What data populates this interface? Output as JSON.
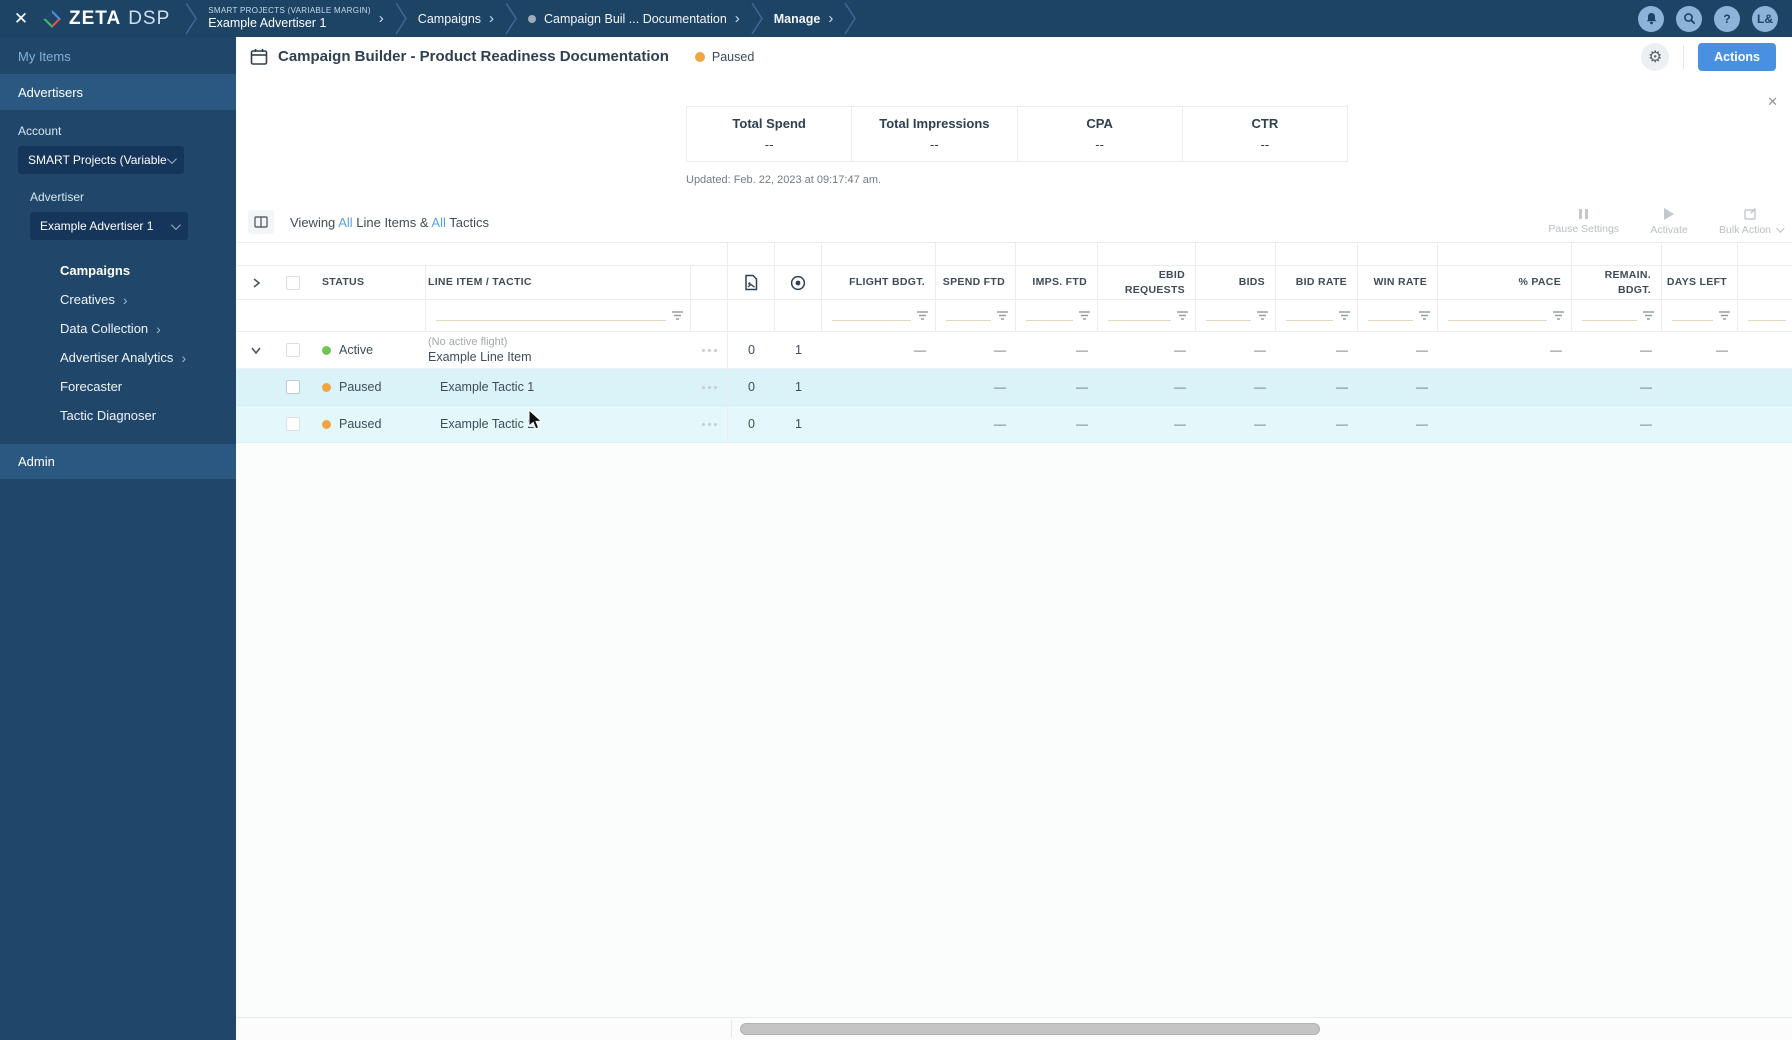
{
  "icons": {
    "close": "✕",
    "gear": "⚙",
    "help": "?",
    "chevron_right": "›"
  },
  "topbar": {
    "brand": "ZETA",
    "product": "DSP",
    "breadcrumb": {
      "account_small": "SMART PROJECTS (VARIABLE MARGIN)",
      "advertiser": "Example Advertiser 1",
      "campaigns": "Campaigns",
      "campaign": "Campaign Buil ... Documentation",
      "manage": "Manage"
    },
    "avatar_initials": "L&"
  },
  "sidebar": {
    "my_items": "My Items",
    "advertisers": "Advertisers",
    "account_label": "Account",
    "account_value": "SMART Projects (Variable M...",
    "advertiser_label": "Advertiser",
    "advertiser_value": "Example Advertiser 1",
    "nav": [
      {
        "label": "Campaigns"
      },
      {
        "label": "Creatives"
      },
      {
        "label": "Data Collection"
      },
      {
        "label": "Advertiser Analytics"
      },
      {
        "label": "Forecaster"
      },
      {
        "label": "Tactic Diagnoser"
      }
    ],
    "admin": "Admin"
  },
  "header": {
    "title": "Campaign Builder - Product Readiness Documentation",
    "status": "Paused",
    "actions_button": "Actions"
  },
  "summary": {
    "stats": [
      {
        "label": "Total Spend",
        "value": "--"
      },
      {
        "label": "Total Impressions",
        "value": "--"
      },
      {
        "label": "CPA",
        "value": "--"
      },
      {
        "label": "CTR",
        "value": "--"
      }
    ],
    "updated": "Updated: Feb. 22, 2023 at 09:17:47 am."
  },
  "toolbar": {
    "viewing_prefix": "Viewing ",
    "all_1": "All",
    "viewing_mid": " Line Items & ",
    "all_2": "All",
    "viewing_suffix": " Tactics",
    "pause_settings": "Pause Settings",
    "activate": "Activate",
    "bulk_action": "Bulk Action"
  },
  "table": {
    "columns": {
      "status": "STATUS",
      "line_item": "LINE ITEM / TACTIC",
      "flight_bdgt": "FLIGHT BDGT.",
      "spend_ftd": "SPEND FTD",
      "imps_ftd": "IMPS. FTD",
      "ebid_requests": "EBID REQUESTS",
      "bids": "BIDS",
      "bid_rate": "BID RATE",
      "win_rate": "WIN RATE",
      "pct_pace": "% PACE",
      "remain_bdgt": "REMAIN. BDGT.",
      "days_left": "DAYS LEFT"
    },
    "rows": [
      {
        "status": "Active",
        "note": "(No active flight)",
        "name": "Example Line Item",
        "creatives": "0",
        "tactics": "1",
        "flight_bdgt": "—",
        "spend_ftd": "—",
        "imps_ftd": "—",
        "ebid_requests": "—",
        "bids": "—",
        "bid_rate": "—",
        "win_rate": "—",
        "pct_pace": "—",
        "remain_bdgt": "—",
        "days_left": "—"
      },
      {
        "status": "Paused",
        "name": "Example Tactic 1",
        "creatives": "0",
        "tactics": "1",
        "spend_ftd": "—",
        "imps_ftd": "—",
        "ebid_requests": "—",
        "bids": "—",
        "bid_rate": "—",
        "win_rate": "—",
        "remain_bdgt": "—"
      },
      {
        "status": "Paused",
        "name": "Example Tactic 2",
        "creatives": "0",
        "tactics": "1",
        "spend_ftd": "—",
        "imps_ftd": "—",
        "ebid_requests": "—",
        "bids": "—",
        "bid_rate": "—",
        "win_rate": "—",
        "remain_bdgt": "—"
      }
    ]
  }
}
